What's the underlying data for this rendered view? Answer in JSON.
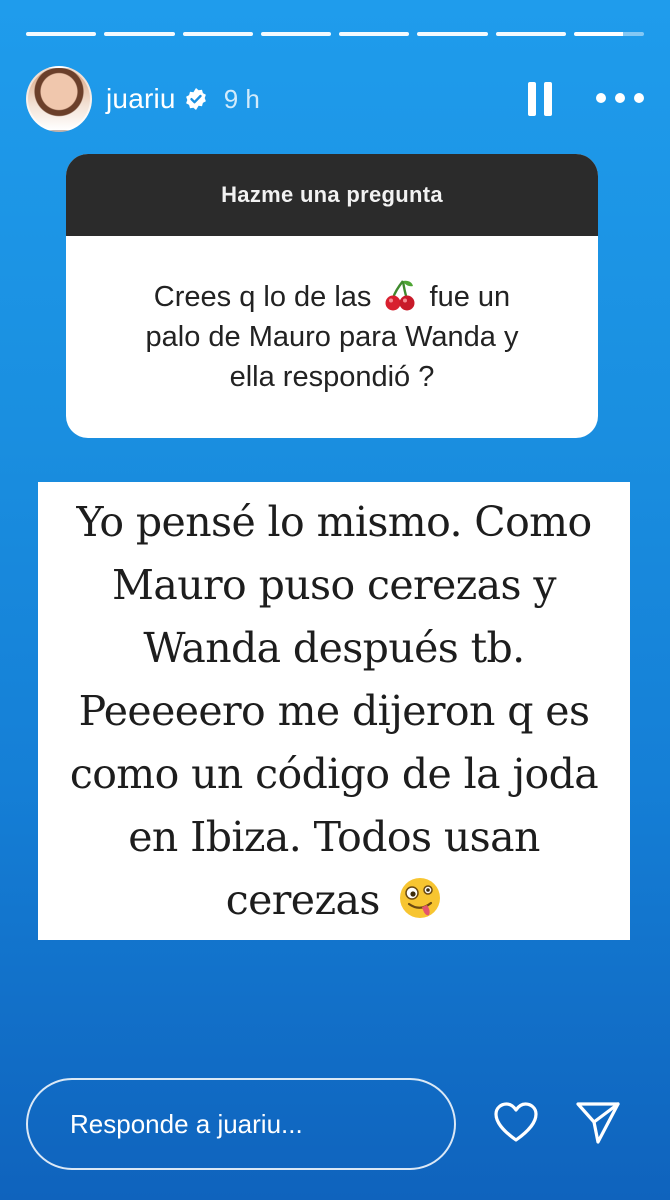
{
  "story": {
    "progress_segments": 8,
    "current_segment_progress": 0.7
  },
  "header": {
    "username": "juariu",
    "time": "9 h",
    "icons": [
      "avatar",
      "verified-badge-icon",
      "pause-icon",
      "more-options-icon"
    ]
  },
  "question_sticker": {
    "title": "Hazme una pregunta",
    "line1_before": "Crees q lo de las",
    "line1_after": "fue un",
    "line2": "palo de Mauro para Wanda y",
    "line3": "ella respondió ?",
    "emoji": "cherry-icon"
  },
  "answer_card": {
    "lines": [
      "Yo pensé lo mismo. Como",
      "Mauro puso cerezas y",
      "Wanda después tb.",
      "Peeeeero me dijeron q es",
      "como un código de la joda",
      "en Ibiza. Todos usan",
      "cerezas"
    ],
    "emoji": "zany-face-icon"
  },
  "footer": {
    "reply_placeholder": "Responde a juariu...",
    "icons": [
      "heart-icon",
      "send-icon"
    ]
  },
  "colors": {
    "background_top": "#1f9cec",
    "background_bottom": "#0f63bd",
    "sticker_header": "#2b2b2b"
  }
}
